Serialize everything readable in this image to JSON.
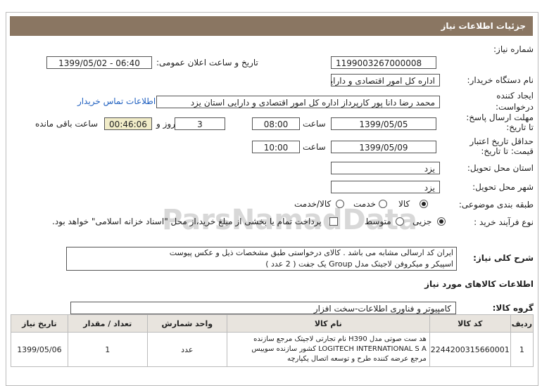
{
  "title": "جزئیات اطلاعات نیاز",
  "fields": {
    "need_number_label": "شماره نیاز:",
    "need_number": "1199003267000008",
    "announce_label": "تاریخ و ساعت اعلان عمومی:",
    "announce_value": "1399/05/02 - 06:40",
    "buyer_label": "نام دستگاه خریدار:",
    "buyer_value": "اداره کل امور اقتصادی و دارایی استان یزد",
    "creator_label": "ایجاد کننده درخواست:",
    "creator_value": "محمد رضا دانا پور  کارپرداز اداره کل امور اقتصادی و دارایی استان یزد",
    "contact_link": "اطلاعات تماس خریدار",
    "deadline_label": "مهلت ارسال پاسخ: تا تاریخ:",
    "deadline_date": "1399/05/05",
    "time_label": "ساعت",
    "deadline_time": "08:00",
    "days_value": "3",
    "days_label": "روز و",
    "remaining_time": "00:46:06",
    "remaining_label": "ساعت باقی مانده",
    "validity_label": "حداقل تاریخ اعتبار قیمت: تا تاریخ:",
    "validity_date": "1399/05/09",
    "validity_time": "10:00",
    "province_label": "استان محل تحویل:",
    "province_value": "یزد",
    "city_label": "شهر محل تحویل:",
    "city_value": "یزد",
    "category_label": "طبقه بندی موضوعی:",
    "category_goods": "کالا",
    "category_service": "خدمت",
    "category_both": "کالا/خدمت",
    "process_label": "نوع فرآیند خرید :",
    "process_partial": "جزیی",
    "process_medium": "متوسط",
    "payment_note": "پرداخت تمام یا بخشی از مبلغ خرید،از محل \"اسناد خزانه اسلامی\" خواهد بود.",
    "general_desc_label": "شرح کلی نیاز:",
    "general_desc_line1": "ایران کد ارسالی مشابه می باشد . کالای درخواستی طبق مشخصات ذیل و عکس پیوست",
    "general_desc_line2": "اسپیکر و میکروفن لاجیتک مدل Group  یک جفت ( 2 عدد )"
  },
  "goods_section_title": "اطلاعات کالاهای مورد نیاز",
  "goods_group_label": "گروه کالا:",
  "goods_group_value": "کامپیوتر و فناوری اطلاعات-سخت افزار",
  "table": {
    "headers": [
      "ردیف",
      "کد کالا",
      "نام کالا",
      "واحد شمارش",
      "تعداد / مقدار",
      "تاریخ نیاز"
    ],
    "rows": [
      {
        "row": "1",
        "code": "2244200315660001",
        "name_line1": "هد ست صوتی مدل H390 نام تجارتی لاجیتک مرجع سازنده",
        "name_line2": "LOGITECH INTERNATIONAL S A کشور سازنده سوییس",
        "name_line3": "مرجع عرضه کننده طرح و توسعه اتصال یکپارچه",
        "unit": "عدد",
        "qty": "1",
        "date": "1399/05/06"
      }
    ]
  }
}
